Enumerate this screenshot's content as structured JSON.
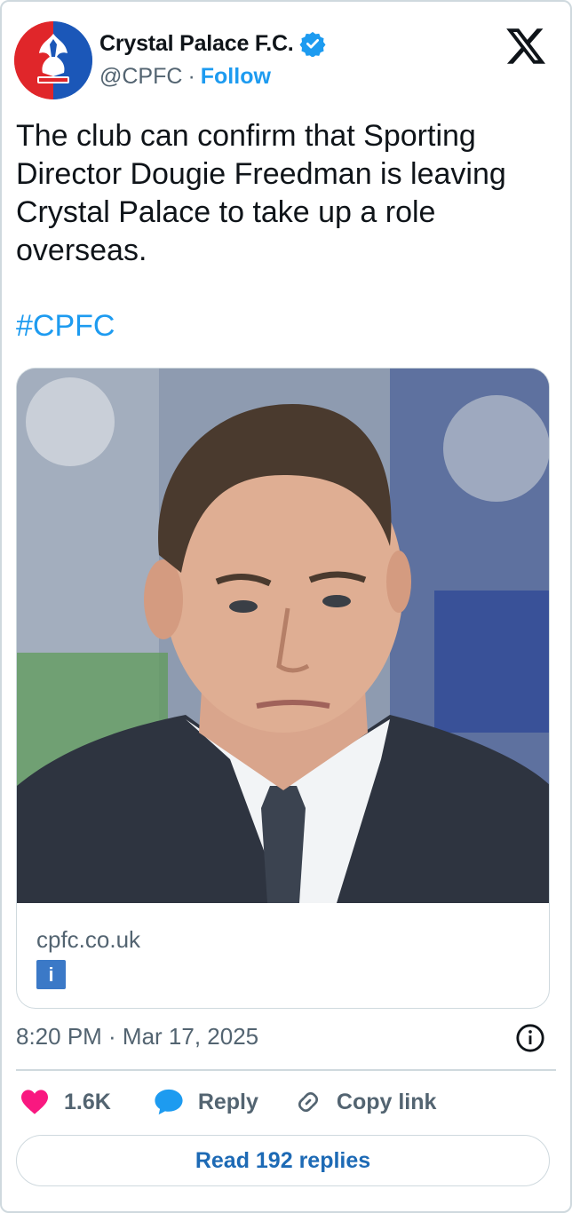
{
  "author": {
    "display_name": "Crystal Palace F.C.",
    "handle": "@CPFC",
    "separator": "·",
    "follow_label": "Follow",
    "verified": true
  },
  "platform_logo": "x-logo-icon",
  "tweet": {
    "text": "The club can confirm that Sporting Director Dougie Freedman is leaving Crystal Palace to take up a role overseas.",
    "hashtag": "#CPFC"
  },
  "link_card": {
    "domain": "cpfc.co.uk",
    "info_badge": "i"
  },
  "timestamp": "8:20 PM · Mar 17, 2025",
  "actions": {
    "like_count": "1.6K",
    "reply_label": "Reply",
    "copy_link_label": "Copy link"
  },
  "read_replies_label": "Read 192 replies",
  "colors": {
    "accent": "#1d9bf0",
    "like": "#f91880",
    "text": "#0f1419",
    "muted": "#536471",
    "border": "#cfd9de"
  }
}
